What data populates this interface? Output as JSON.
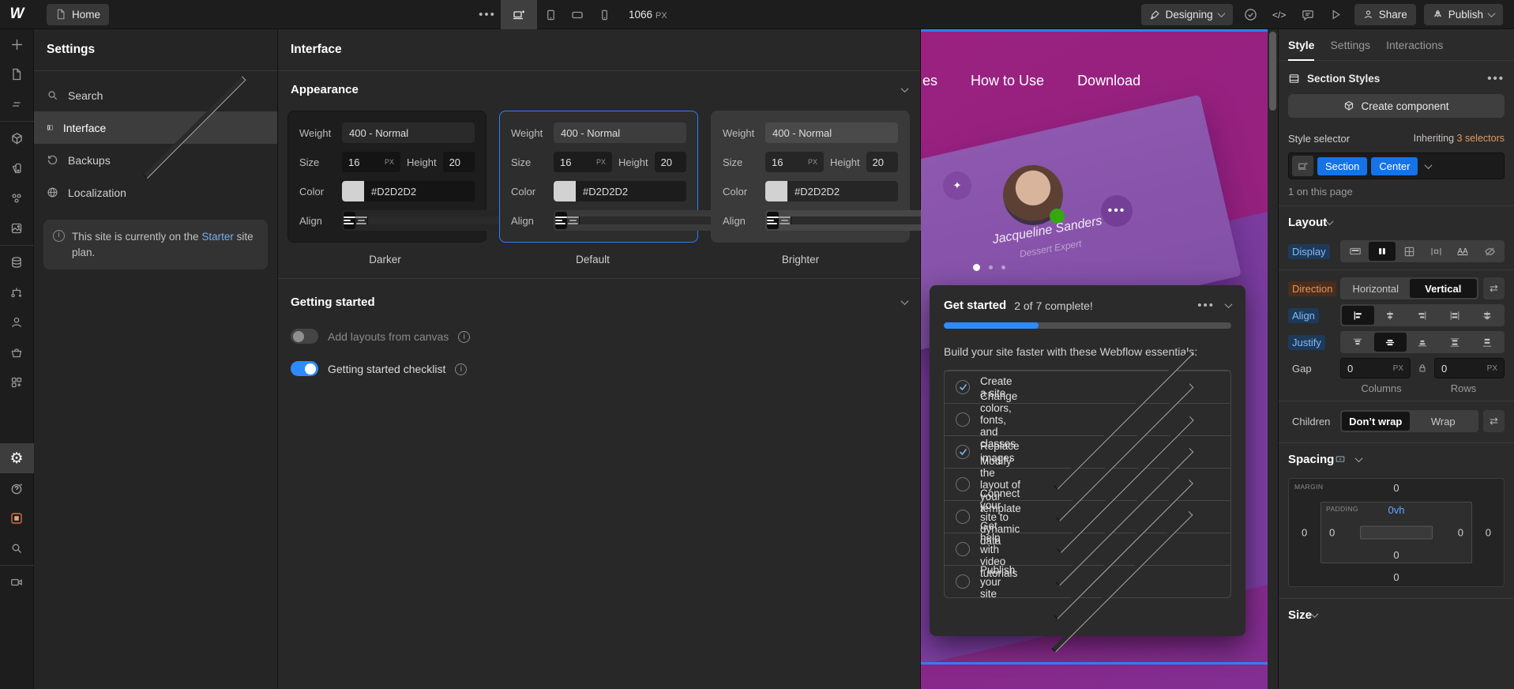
{
  "topbar": {
    "home": "Home",
    "breakpoint_width": "1066",
    "breakpoint_unit": "PX",
    "mode": "Designing",
    "share": "Share",
    "publish": "Publish"
  },
  "settings_panel": {
    "title": "Settings",
    "items": [
      {
        "label": "Search"
      },
      {
        "label": "Interface"
      },
      {
        "label": "Backups"
      },
      {
        "label": "Localization"
      }
    ],
    "notice": {
      "text_before": "This site is currently on the ",
      "link": "Starter",
      "text_after": " site plan."
    }
  },
  "main_panel": {
    "title": "Interface",
    "appearance_title": "Appearance",
    "field_labels": {
      "weight": "Weight",
      "size": "Size",
      "height": "Height",
      "color": "Color",
      "align": "Align"
    },
    "themes": [
      {
        "name": "Darker",
        "tone": "darker",
        "selected": false,
        "weight": "400 - Normal",
        "size": "16",
        "size_unit": "PX",
        "height": "20",
        "color": "#D2D2D2"
      },
      {
        "name": "Default",
        "tone": "default",
        "selected": true,
        "weight": "400 - Normal",
        "size": "16",
        "size_unit": "PX",
        "height": "20",
        "color": "#D2D2D2"
      },
      {
        "name": "Brighter",
        "tone": "brighter",
        "selected": false,
        "weight": "400 - Normal",
        "size": "16",
        "size_unit": "PX",
        "height": "20",
        "color": "#D2D2D2"
      }
    ],
    "getting_started": {
      "title": "Getting started",
      "toggles": [
        {
          "label": "Add layouts from canvas",
          "on": false
        },
        {
          "label": "Getting started checklist",
          "on": true
        }
      ]
    }
  },
  "canvas": {
    "nav": [
      "es",
      "How to Use",
      "Download"
    ],
    "profile": {
      "name": "Jacqueline Sanders",
      "role": "Dessert Expert"
    },
    "get_started": {
      "title": "Get started",
      "progress_text": "2 of 7 complete!",
      "progress_pct": 33,
      "subtitle": "Build your site faster with these Webflow essentials:",
      "items": [
        {
          "label": "Create a site",
          "checked": true,
          "chevron": false
        },
        {
          "label": "Change colors, fonts, and classes",
          "checked": false,
          "chevron": true
        },
        {
          "label": "Replace images",
          "checked": true,
          "chevron": true
        },
        {
          "label": "Modify the layout of your template",
          "checked": false,
          "chevron": true
        },
        {
          "label": "Connect your site to dynamic data",
          "checked": false,
          "chevron": true
        },
        {
          "label": "Get help with video tutorials",
          "checked": false,
          "chevron": true
        },
        {
          "label": "Publish your site",
          "checked": false,
          "chevron": true
        }
      ]
    }
  },
  "right_panel": {
    "tabs": [
      {
        "label": "Style"
      },
      {
        "label": "Settings"
      },
      {
        "label": "Interactions"
      }
    ],
    "section_styles": "Section Styles",
    "create_component": "Create component",
    "style_selector_label": "Style selector",
    "inheriting": "Inheriting",
    "inheriting_count": "3 selectors",
    "selector_tags": [
      "Section",
      "Center"
    ],
    "on_page": "1 on this page",
    "layout": {
      "title": "Layout",
      "display_label": "Display",
      "direction_label": "Direction",
      "direction_options": [
        "Horizontal",
        "Vertical"
      ],
      "direction_selected": "Vertical",
      "align_label": "Align",
      "justify_label": "Justify",
      "gap_label": "Gap",
      "gap_columns": "0",
      "gap_rows": "0",
      "gap_unit": "PX",
      "columns_label": "Columns",
      "rows_label": "Rows",
      "children_label": "Children",
      "children_options": [
        "Don’t wrap",
        "Wrap"
      ],
      "children_selected": "Don’t wrap"
    },
    "spacing": {
      "title": "Spacing",
      "margin_label": "MARGIN",
      "padding_label": "PADDING",
      "margin": {
        "top": "0",
        "right": "0",
        "bottom": "0",
        "left": "0"
      },
      "padding": {
        "top": "0vh",
        "right": "0",
        "bottom": "0",
        "left": "0"
      }
    },
    "size_title": "Size"
  },
  "colors": {
    "accent_blue": "#1673e6",
    "progress_blue": "#2e8bff",
    "selection_blue": "#2e7ff7",
    "orange_text": "#e09a5e",
    "canvas_magenta": "#97217f",
    "canvas_purple": "#7b3da0",
    "theme_text_color": "#D2D2D2"
  }
}
